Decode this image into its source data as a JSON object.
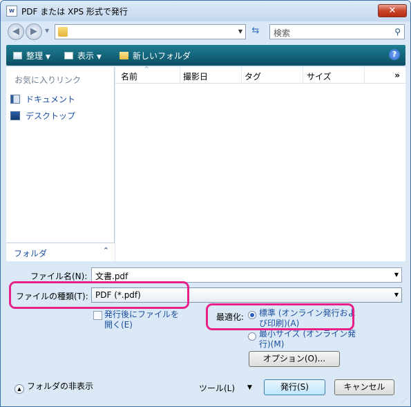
{
  "window": {
    "title": "PDF または XPS 形式で発行",
    "app_icon": "W"
  },
  "nav": {
    "search_placeholder": "検索"
  },
  "toolbar": {
    "organize": "整理",
    "views": "表示",
    "new_folder": "新しいフォルダ"
  },
  "sidebar": {
    "favorites_header": "お気に入りリンク",
    "links": [
      {
        "label": "ドキュメント",
        "icon": "documents-icon"
      },
      {
        "label": "デスクトップ",
        "icon": "desktop-icon"
      }
    ],
    "folders_label": "フォルダ"
  },
  "filelist": {
    "columns": [
      "名前",
      "撮影日",
      "タグ",
      "サイズ"
    ]
  },
  "form": {
    "filename_label": "ファイル名(N):",
    "filename_value": "文書.pdf",
    "filetype_label": "ファイルの種類(T):",
    "filetype_value": "PDF (*.pdf)",
    "open_after_label_line1": "発行後にファイルを",
    "open_after_label_line2": "開く(E)",
    "open_after_checked": false,
    "optimize_label": "最適化:",
    "optimize_standard_line1": "標準 (オンライン発行およ",
    "optimize_standard_line2": "び印刷)(A)",
    "optimize_minimum_line1": "最小サイズ (オンライン発",
    "optimize_minimum_line2": "行)(M)",
    "optimize_selected": "standard",
    "options_button": "オプション(O)..."
  },
  "footer": {
    "hide_folders": "フォルダの非表示",
    "tools": "ツール(L)",
    "publish": "発行(S)",
    "cancel": "キャンセル"
  },
  "colors": {
    "toolbar": "#0c4f63",
    "highlight": "#e8218a",
    "link": "#1b4fa0"
  }
}
